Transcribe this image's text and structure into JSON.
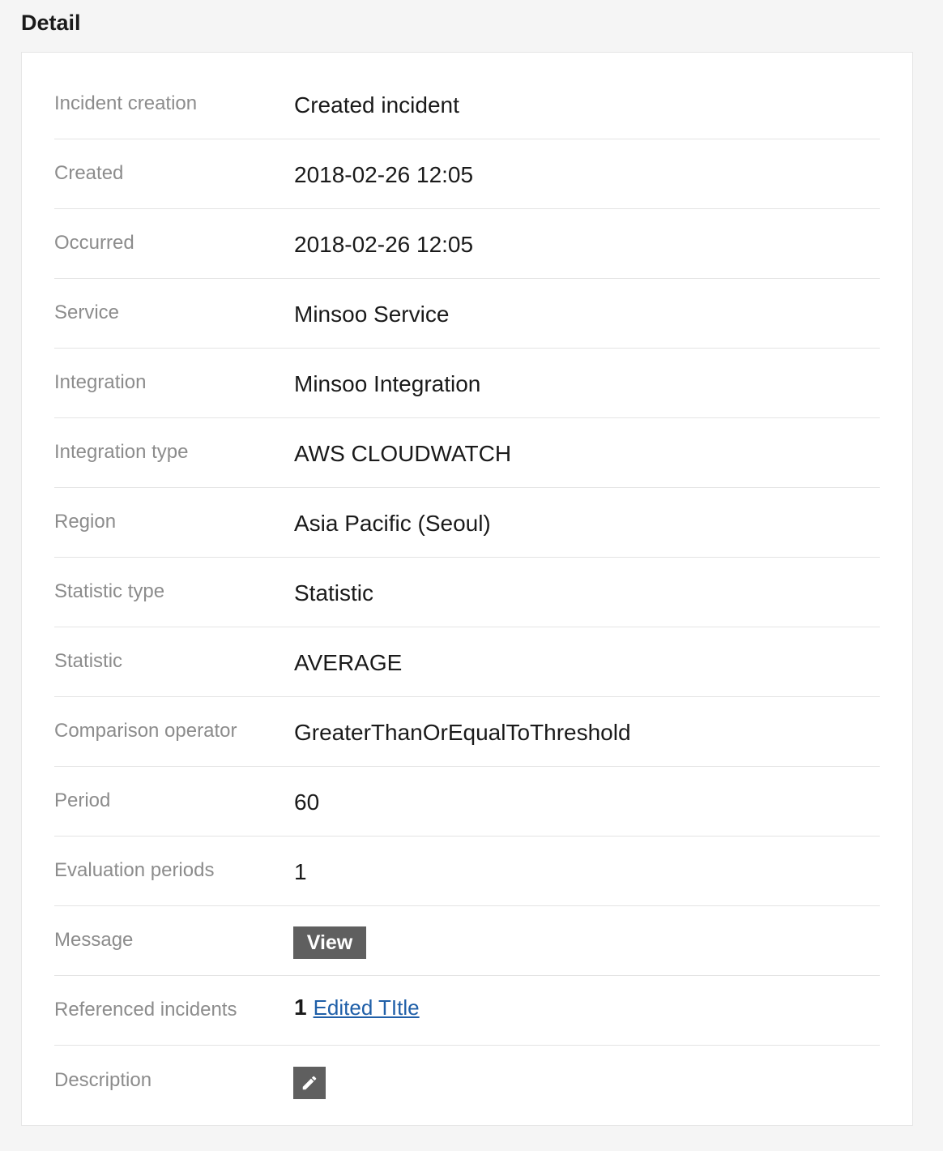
{
  "title": "Detail",
  "rows": {
    "incident_creation": {
      "label": "Incident creation",
      "value": "Created incident"
    },
    "created": {
      "label": "Created",
      "value": "2018-02-26 12:05"
    },
    "occurred": {
      "label": "Occurred",
      "value": "2018-02-26 12:05"
    },
    "service": {
      "label": "Service",
      "value": "Minsoo Service"
    },
    "integration": {
      "label": "Integration",
      "value": "Minsoo Integration"
    },
    "integration_type": {
      "label": "Integration type",
      "value": "AWS CLOUDWATCH"
    },
    "region": {
      "label": "Region",
      "value": "Asia Pacific (Seoul)"
    },
    "statistic_type": {
      "label": "Statistic type",
      "value": "Statistic"
    },
    "statistic": {
      "label": "Statistic",
      "value": "AVERAGE"
    },
    "comparison_operator": {
      "label": "Comparison operator",
      "value": "GreaterThanOrEqualToThreshold"
    },
    "period": {
      "label": "Period",
      "value": "60"
    },
    "evaluation_periods": {
      "label": "Evaluation periods",
      "value": "1"
    },
    "message": {
      "label": "Message",
      "button_label": "View"
    },
    "referenced_incidents": {
      "label": "Referenced incidents",
      "count": "1",
      "link_text": "Edited TItle"
    },
    "description": {
      "label": "Description",
      "icon": "pencil-icon"
    }
  },
  "colors": {
    "label": "#8c8c8c",
    "value": "#1a1a1a",
    "button_bg": "#5f5f5f",
    "link": "#1f5fa8",
    "page_bg": "#f5f5f5"
  }
}
